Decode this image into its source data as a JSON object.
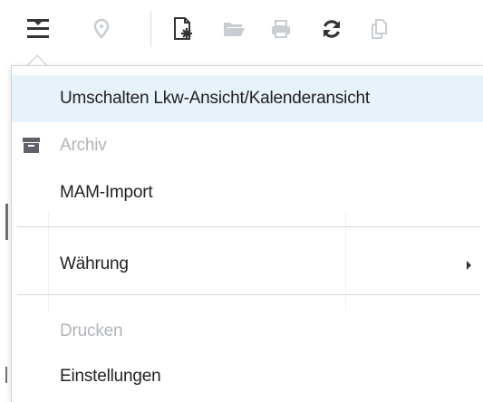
{
  "toolbar": {
    "buttons": [
      {
        "name": "view-toggle-icon",
        "state": "active"
      },
      {
        "name": "location-pin-icon",
        "state": "disabled"
      },
      {
        "name": "new-document-icon",
        "state": "enabled"
      },
      {
        "name": "open-folder-icon",
        "state": "disabled"
      },
      {
        "name": "print-icon",
        "state": "disabled"
      },
      {
        "name": "refresh-icon",
        "state": "enabled"
      },
      {
        "name": "copy-icon",
        "state": "disabled"
      }
    ]
  },
  "menu": {
    "items": [
      {
        "label": "Umschalten Lkw-Ansicht/Kalenderansicht",
        "state": "highlighted"
      },
      {
        "label": "Archiv",
        "state": "disabled",
        "icon": "archive-box-icon"
      },
      {
        "label": "MAM-Import",
        "state": "enabled"
      },
      {
        "label": "Währung",
        "state": "enabled",
        "submenu": true
      },
      {
        "label": "Drucken",
        "state": "disabled"
      },
      {
        "label": "Einstellungen",
        "state": "enabled"
      }
    ]
  },
  "colors": {
    "highlight_bg": "#e8f2fb",
    "disabled_text": "#b0b4b9",
    "enabled_text": "#222222",
    "icon_dark": "#333333",
    "icon_disabled": "#c8cdd2"
  }
}
